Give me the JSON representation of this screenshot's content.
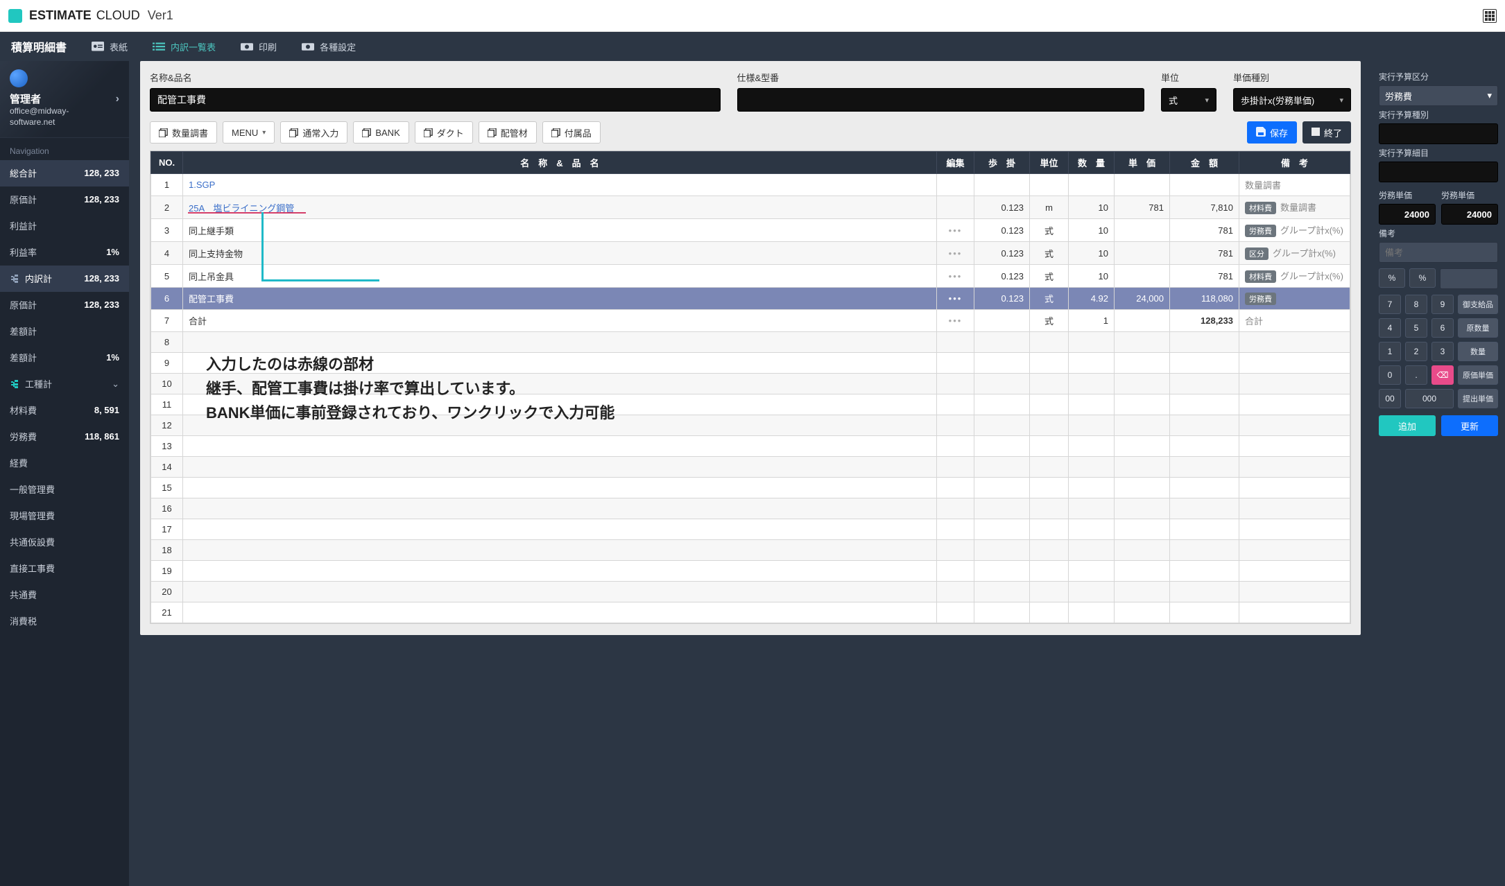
{
  "brand": {
    "name": "ESTIMATE",
    "suffix": "CLOUD",
    "version": "Ver1"
  },
  "page_tabs": {
    "title": "積算明細書",
    "items": [
      {
        "label": "表紙"
      },
      {
        "label": "内訳一覧表",
        "active": true
      },
      {
        "label": "印刷"
      },
      {
        "label": "各種設定"
      }
    ]
  },
  "user": {
    "role": "管理者",
    "email1": "office@midway-",
    "email2": "software.net"
  },
  "nav": {
    "heading": "Navigation",
    "items": [
      {
        "label": "総合計",
        "value": "128, 233",
        "active": true
      },
      {
        "label": "原価計",
        "value": "128, 233"
      },
      {
        "label": "利益計",
        "value": ""
      },
      {
        "label": "利益率",
        "value": "1%"
      },
      {
        "label": "内訳計",
        "value": "128, 233",
        "icon": true,
        "active": true
      },
      {
        "label": "原価計",
        "value": "128, 233"
      },
      {
        "label": "差額計",
        "value": ""
      },
      {
        "label": "差額計",
        "value": "1%"
      },
      {
        "label": "工種計",
        "value": "",
        "icon": true,
        "green": true,
        "chev": true
      },
      {
        "label": "材料費",
        "value": "8, 591"
      },
      {
        "label": "労務費",
        "value": "118, 861"
      },
      {
        "label": "経費",
        "value": ""
      },
      {
        "label": "一般管理費",
        "value": ""
      },
      {
        "label": "現場管理費",
        "value": ""
      },
      {
        "label": "共通仮設費",
        "value": ""
      },
      {
        "label": "直接工事費",
        "value": ""
      },
      {
        "label": "共通費",
        "value": ""
      },
      {
        "label": "消費税",
        "value": ""
      }
    ]
  },
  "form": {
    "name_label": "名称&品名",
    "name_value": "配管工事費",
    "spec_label": "仕様&型番",
    "spec_value": "",
    "unit_label": "単位",
    "unit_value": "式",
    "type_label": "単価種別",
    "type_value": "歩掛計x(労務単価)"
  },
  "toolbar": {
    "qty_adjust": "数量調書",
    "menu": "MENU",
    "normal": "通常入力",
    "bank": "BANK",
    "duct": "ダクト",
    "pipe": "配管材",
    "attach": "付属品",
    "save": "保存",
    "finish": "終了"
  },
  "columns": {
    "no": "NO.",
    "name": "名　称　&　品　名",
    "edit": "編集",
    "bukake": "歩　掛",
    "unit": "単位",
    "qty": "数　量",
    "tanka": "単　価",
    "kingaku": "金　額",
    "bikou": "備　考"
  },
  "rows": [
    {
      "no": 1,
      "name": "1.SGP",
      "link": true,
      "bukake": "",
      "unit": "",
      "qty": "",
      "tanka": "",
      "kingaku": "",
      "bikou_text": "数量調書"
    },
    {
      "no": 2,
      "name": "25A　塩ビライニング鋼管",
      "link": true,
      "underline": true,
      "bukake": "0.123",
      "unit": "m",
      "qty": "10",
      "tanka": "781",
      "kingaku": "7,810",
      "badge": "材料費",
      "bikou_text": "数量調書"
    },
    {
      "no": 3,
      "name": "同上継手類",
      "dots": true,
      "bukake": "0.123",
      "unit": "式",
      "qty": "10",
      "tanka": "",
      "kingaku": "781",
      "badge": "労務費",
      "bikou_text": "グループ計x(%)"
    },
    {
      "no": 4,
      "name": "同上支持金物",
      "dots": true,
      "bukake": "0.123",
      "unit": "式",
      "qty": "10",
      "tanka": "",
      "kingaku": "781",
      "badge": "区分",
      "bikou_text": "グループ計x(%)"
    },
    {
      "no": 5,
      "name": "同上吊金具",
      "dots": true,
      "bukake": "0.123",
      "unit": "式",
      "qty": "10",
      "tanka": "",
      "kingaku": "781",
      "badge": "材料費",
      "bikou_text": "グループ計x(%)"
    },
    {
      "no": 6,
      "name": "配管工事費",
      "hl": true,
      "dots": true,
      "bukake": "0.123",
      "unit": "式",
      "qty": "4.92",
      "tanka": "24,000",
      "kingaku": "118,080",
      "badge": "労務費",
      "bikou_text": ""
    },
    {
      "no": 7,
      "name": "合計",
      "dots": true,
      "bukake": "",
      "unit": "式",
      "qty": "1",
      "tanka": "",
      "kingaku": "128,233",
      "bikou_text": "合計",
      "bold": true
    }
  ],
  "empty_from": 8,
  "empty_to": 21,
  "annotation": {
    "l1": "入力したのは赤線の部材",
    "l2": "継手、配管工事費は掛け率で算出しています。",
    "l3": "BANK単価に事前登録されており、ワンクリックで入力可能"
  },
  "inspector": {
    "budget_label": "実行予算区分",
    "budget_value": "労務費",
    "type_label": "実行予算種別",
    "type_value": "",
    "detail_label": "実行予算細目",
    "detail_value": "",
    "labor_label": "労務単価",
    "labor_val_a": "24000",
    "labor_val_b": "24000",
    "bikou_label": "備考",
    "bikou_placeholder": "備考",
    "pct": "%",
    "keys": {
      "k7": "7",
      "k8": "8",
      "k9": "9",
      "r1": "御支給品",
      "k4": "4",
      "k5": "5",
      "k6": "6",
      "r2": "原数量",
      "k1": "1",
      "k2": "2",
      "k3": "3",
      "r3": "数量",
      "k0": "0",
      "kdot": ".",
      "kdel": "⌫",
      "r4": "原価単価",
      "k00": "00",
      "k000": "000",
      "r5": "提出単価"
    },
    "add": "追加",
    "update": "更新"
  }
}
